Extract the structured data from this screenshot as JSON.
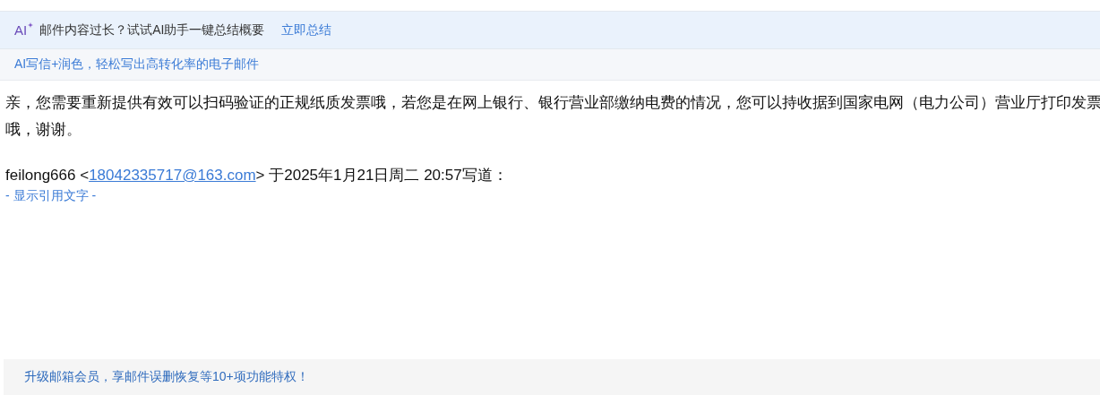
{
  "ai_banner": {
    "logo": "AI",
    "message": "邮件内容过长？试试AI助手一键总结概要",
    "action": "立即总结"
  },
  "promo_bar": {
    "text": "AI写信+润色，轻松写出高转化率的电子邮件"
  },
  "body": {
    "lines": [
      "亲，您需要重新提供有效可以扫码验证的正规纸质发票哦，若您是在网上银行、银行营业部缴纳电费的情况，您可以持收据到国家电网（电力公司）营业厅打印发票",
      "哦，谢谢。"
    ]
  },
  "quote_header": {
    "sender": "feilong666 <",
    "email": "18042335717@163.com",
    "suffix": "> 于2025年1月21日周二 20:57写道："
  },
  "show_quote": "- 显示引用文字 -",
  "footer_banner": {
    "text": "升级邮箱会员，享邮件误删恢复等10+项功能特权！"
  }
}
